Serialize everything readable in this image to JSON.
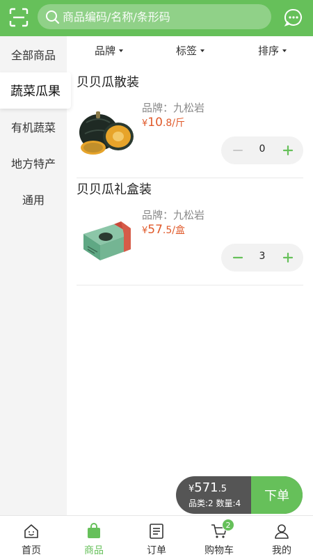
{
  "header": {
    "search_placeholder": "商品编码/名称/条形码",
    "accent_color": "#66c05a"
  },
  "sidebar": {
    "items": [
      {
        "label": "全部商品",
        "active": false
      },
      {
        "label": "蔬菜瓜果",
        "active": true
      },
      {
        "label": "有机蔬菜",
        "active": false
      },
      {
        "label": "地方特产",
        "active": false
      },
      {
        "label": "通用",
        "active": false
      }
    ]
  },
  "filters": [
    {
      "label": "品牌"
    },
    {
      "label": "标签"
    },
    {
      "label": "排序"
    }
  ],
  "products": [
    {
      "name": "贝贝瓜散装",
      "brand": "品牌：九松岩",
      "price_currency": "¥",
      "price_main": "10",
      "price_decimal": ".8",
      "price_unit": "/斤",
      "quantity": "0",
      "image_icon": "pumpkin-image"
    },
    {
      "name": "贝贝瓜礼盒装",
      "brand": "品牌：九松岩",
      "price_currency": "¥",
      "price_main": "57",
      "price_decimal": ".5",
      "price_unit": "/盒",
      "quantity": "3",
      "image_icon": "gift-box-image"
    }
  ],
  "cart": {
    "currency": "¥",
    "total_main": "571",
    "total_decimal": ".5",
    "stats": "品类:2 数量:4",
    "order_label": "下单"
  },
  "tabbar": {
    "tabs": [
      {
        "label": "首页",
        "icon": "home-icon",
        "active": false
      },
      {
        "label": "商品",
        "icon": "bag-icon",
        "active": true
      },
      {
        "label": "订单",
        "icon": "order-icon",
        "active": false
      },
      {
        "label": "购物车",
        "icon": "cart-icon",
        "active": false,
        "badge": "2"
      },
      {
        "label": "我的",
        "icon": "user-icon",
        "active": false
      }
    ]
  }
}
